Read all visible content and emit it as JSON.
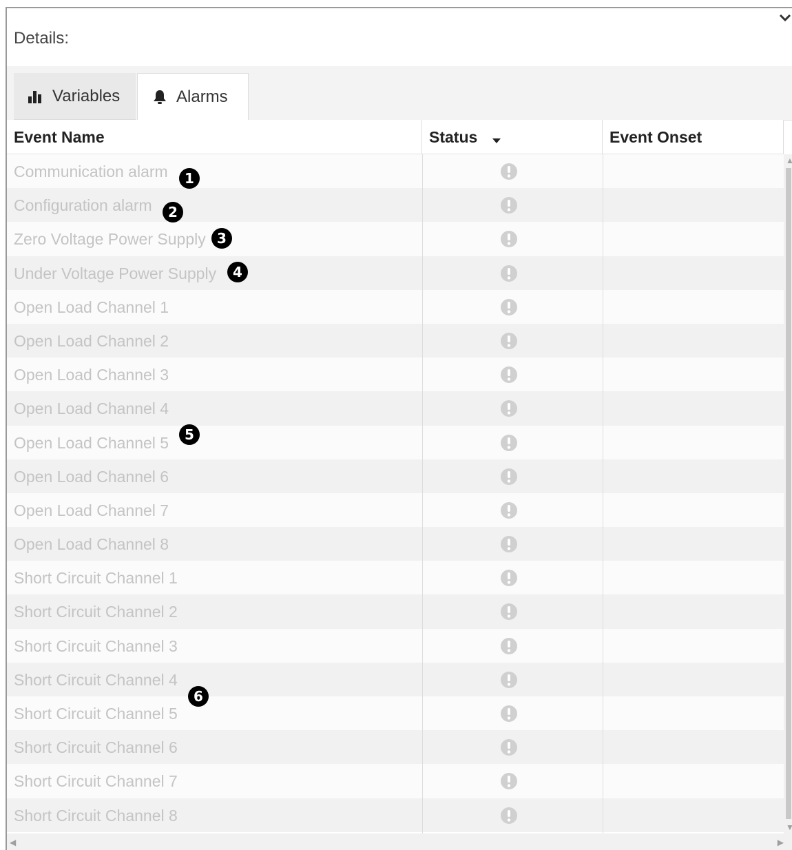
{
  "details": {
    "title": "Details:"
  },
  "tabs": [
    {
      "label": "Variables",
      "icon": "bar-chart-icon",
      "active": false
    },
    {
      "label": "Alarms",
      "icon": "bell-icon",
      "active": true
    }
  ],
  "table": {
    "columns": [
      "Event Name",
      "Status",
      "Event Onset"
    ],
    "sort_column": "Status",
    "rows": [
      {
        "name": "Communication alarm"
      },
      {
        "name": "Configuration alarm"
      },
      {
        "name": "Zero Voltage Power Supply"
      },
      {
        "name": "Under Voltage Power Supply"
      },
      {
        "name": "Open Load Channel 1"
      },
      {
        "name": "Open Load Channel 2"
      },
      {
        "name": "Open Load Channel 3"
      },
      {
        "name": "Open Load Channel 4"
      },
      {
        "name": "Open Load Channel 5"
      },
      {
        "name": "Open Load Channel 6"
      },
      {
        "name": "Open Load Channel 7"
      },
      {
        "name": "Open Load Channel 8"
      },
      {
        "name": "Short Circuit Channel 1"
      },
      {
        "name": "Short Circuit Channel 2"
      },
      {
        "name": "Short Circuit Channel 3"
      },
      {
        "name": "Short Circuit Channel 4"
      },
      {
        "name": "Short Circuit Channel 5"
      },
      {
        "name": "Short Circuit Channel 6"
      },
      {
        "name": "Short Circuit Channel 7"
      },
      {
        "name": "Short Circuit Channel 8"
      }
    ],
    "status_icon": "exclamation-circle-icon"
  },
  "callouts": [
    "1",
    "2",
    "3",
    "4",
    "5",
    "6"
  ],
  "colors": {
    "inactive_text": "#c4c4c4",
    "status_icon": "#d0d0d0",
    "row_odd": "#fbfbfb",
    "row_even": "#f1f1f1"
  }
}
